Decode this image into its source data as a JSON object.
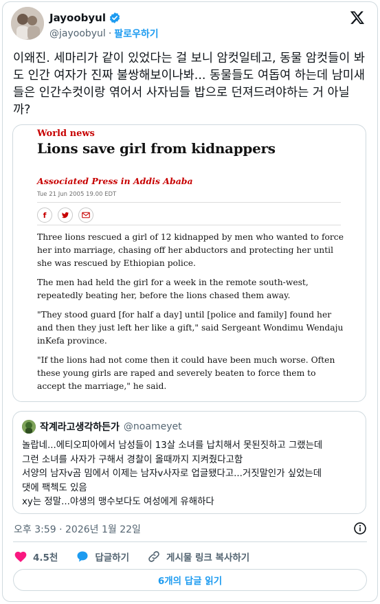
{
  "author": {
    "name": "Jayoobyul",
    "handle": "@jayoobyul",
    "separator": "·",
    "follow_label": "팔로우하기"
  },
  "tweet": {
    "text": "이왜진. 세마리가 같이 있었다는 걸 보니 암컷일테고, 동물 암컷들이 봐도 인간 여자가 진짜 불쌍해보이나봐... 동물들도 여돕여 하는데 남미새들은 인간수컷이랑 엮어서 사자님들 밥으로 던져드려야하는 거 아닐까?"
  },
  "article": {
    "section": "World news",
    "headline": "Lions save girl from kidnappers",
    "byline": "Associated Press in Addis Ababa",
    "date": "Tue 21 Jun 2005 19.00 EDT",
    "paragraphs": [
      "Three lions rescued a girl of 12 kidnapped by men who wanted to force her into marriage, chasing off her abductors and protecting her until she was rescued by Ethiopian police.",
      "The men had held the girl for a week in the remote south-west, repeatedly beating her, before the lions chased them away.",
      "\"They stood guard [for half a day] until [police and family] found her and then they just left her like a gift,\" said Sergeant Wondimu Wendaju inKefa province.",
      "\"If the lions had not come then it could have been much worse. Often these young girls are raped and severely beaten to force them to accept the marriage,\" he said."
    ]
  },
  "quote": {
    "name": "작계라고생각하든가",
    "handle": "@noameyet",
    "lines": [
      "놀랍네...에티오피아에서 남성들이 13살 소녀를 납치해서 못된짓하고 그랬는데",
      "그런 소녀를 사자가 구해서 경찰이 올때까지 지켜줬다고함",
      "서양의 남자v곰 밈에서 이제는 남자v사자로 업글됐다고...거짓말인가 싶었는데",
      "댓에 팩첵도 있음",
      "xy는 정말...야생의 맹수보다도 여성에게 유해하다"
    ]
  },
  "meta": {
    "timestamp": "오후 3:59 · 2026년 1월 22일"
  },
  "actions": {
    "likes": "4.5천",
    "reply_label": "답글하기",
    "copy_label": "게시물 링크 복사하기"
  },
  "read_replies_label": "6개의 답글 읽기",
  "colors": {
    "accent": "#1d9bf0",
    "like": "#f91880",
    "guardian_red": "#c70000"
  }
}
